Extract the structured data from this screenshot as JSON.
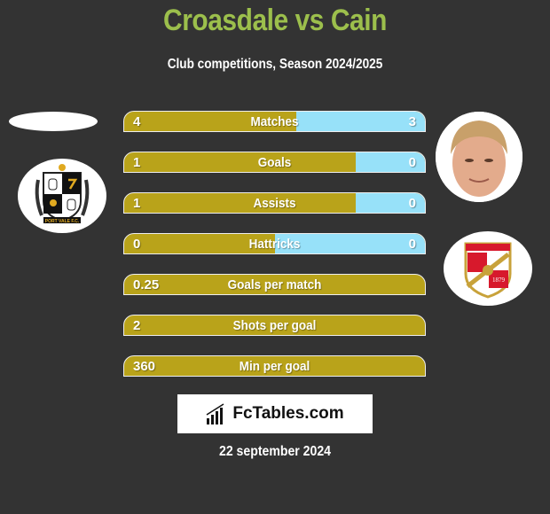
{
  "header": {
    "title": "Croasdale vs Cain",
    "subtitle": "Club competitions, Season 2024/2025"
  },
  "colors": {
    "background": "#333333",
    "title": "#9cbf4c",
    "left_bar": "#b9a31a",
    "right_bar": "#97e1f9"
  },
  "left_player": {
    "name": "Croasdale",
    "club_badge": "port-vale-badge",
    "badge_text": "PORT VALE F.C."
  },
  "right_player": {
    "name": "Cain",
    "photo": "player-photo",
    "club_badge": "swindon-town-badge",
    "badge_year": "1879"
  },
  "stats": [
    {
      "label": "Matches",
      "left": "4",
      "right": "3",
      "right_share": 0.4286
    },
    {
      "label": "Goals",
      "left": "1",
      "right": "0",
      "right_share": 0.23
    },
    {
      "label": "Assists",
      "left": "1",
      "right": "0",
      "right_share": 0.23
    },
    {
      "label": "Hattricks",
      "left": "0",
      "right": "0",
      "right_share": 0.5
    },
    {
      "label": "Goals per match",
      "left": "0.25",
      "right": null,
      "right_share": 0
    },
    {
      "label": "Shots per goal",
      "left": "2",
      "right": null,
      "right_share": 0
    },
    {
      "label": "Min per goal",
      "left": "360",
      "right": null,
      "right_share": 0
    }
  ],
  "footer": {
    "logo_text": "FcTables.com",
    "date": "22 september 2024"
  }
}
